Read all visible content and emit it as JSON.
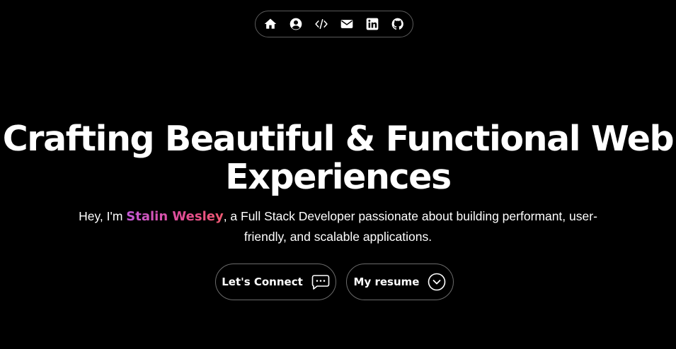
{
  "nav": {
    "items": [
      {
        "icon": "home-icon"
      },
      {
        "icon": "user-icon"
      },
      {
        "icon": "code-icon"
      },
      {
        "icon": "mail-icon"
      },
      {
        "icon": "linkedin-icon"
      },
      {
        "icon": "github-icon"
      }
    ]
  },
  "hero": {
    "title": "Crafting Beautiful & Functional Web Experiences",
    "subtitle_prefix": "Hey, I'm ",
    "name": "Stalin Wesley",
    "subtitle_suffix": ", a Full Stack Developer passionate about building performant, user-friendly, and scalable applications."
  },
  "buttons": {
    "connect_label": "Let's Connect",
    "connect_icon": "chat-bubble-icon",
    "resume_label": "My resume",
    "resume_icon": "chevron-down-circle-icon"
  },
  "colors": {
    "background": "#000000",
    "text": "#ffffff",
    "name_gradient_start": "#c45ad8",
    "name_gradient_end": "#f05a72",
    "border": "#6b6b6b"
  }
}
